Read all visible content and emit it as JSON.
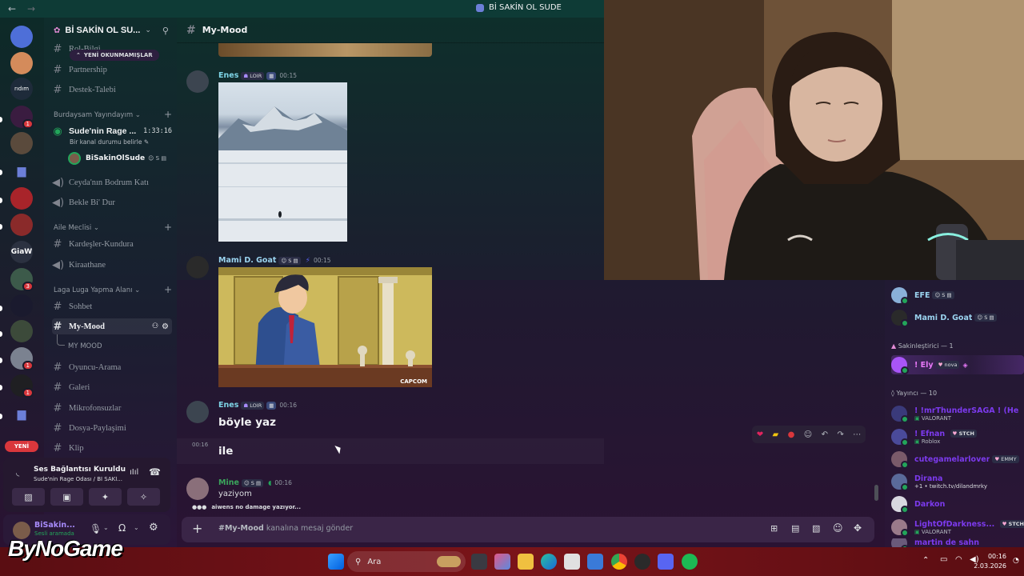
{
  "window": {
    "title": "Bİ SAKİN OL SUDE"
  },
  "server": {
    "name": "Bİ SAKİN OL SU...",
    "unread_pill": "YENİ OKUNMAMIŞLAR",
    "new_pill": "YENİ",
    "badges": [
      "1",
      "1",
      "3",
      "1",
      "1"
    ]
  },
  "channels": {
    "partial_top": "Rol-Bilgi",
    "partnership": "Partnership",
    "destek": "Destek-Talebi",
    "cat_burdaysam": "Burdaysam Yayındayım",
    "voice_active": {
      "name": "Sude'nin Rage ...",
      "timer": "1:33:16",
      "status": "Bir kanal durumu belirle",
      "member": "BiSakinOlSude"
    },
    "ceyda": "Ceyda'nın Bodrum Katı",
    "bekle": "Bekle Bi' Dur",
    "cat_aile": "Aile Meclisi",
    "kardesler": "Kardeşler-Kundura",
    "kiraathane": "Kiraathane",
    "cat_laga": "Laga Luga Yapma Alanı",
    "sohbet": "Sohbet",
    "mymood": "My-Mood",
    "thread": "MY MOOD",
    "oyuncu": "Oyuncu-Arama",
    "galeri": "Galeri",
    "mikrofonsuzlar": "Mikrofonsuzlar",
    "dosya": "Dosya-Paylaşimi",
    "klip": "Klip"
  },
  "voice_panel": {
    "status": "Ses Bağlantısı Kuruldu",
    "location": "Sude'nin Rage Odası / Bİ SAKİ..."
  },
  "user_panel": {
    "name": "BiSakin...",
    "status": "Sesli aramada"
  },
  "chat": {
    "channel": "My-Mood",
    "messages": [
      {
        "author": "Enes",
        "tag": "LOIR",
        "time": "00:15"
      },
      {
        "author": "Mami D. Goat",
        "tag": "S",
        "time": "00:15"
      },
      {
        "author": "Enes",
        "tag": "LOIR",
        "time": "00:16",
        "text": "böyle yaz"
      },
      {
        "time_side": "00:16",
        "text": "ile"
      },
      {
        "author": "Mine",
        "tag": "S",
        "time": "00:16",
        "text": "yaziyom"
      }
    ],
    "court_caption": "CAPCOM",
    "typing": "aiwens no damage yazıyor...",
    "composer_placeholder": "#My-Mood kanalına mesaj gönder",
    "composer_prefix": "#My-Mood",
    "composer_suffix": "kanalına mesaj gönder"
  },
  "members": {
    "list_top": [
      {
        "name": "EFE",
        "color": "#9bd4f0"
      },
      {
        "name": "Mami D. Goat",
        "color": "#9bd4f0"
      }
    ],
    "cat_sakin": "Sakinleştirici — 1",
    "ely": {
      "name": "! Ely",
      "tag": "nova"
    },
    "cat_yayinci": "Yayıncı — 10",
    "streamers": [
      {
        "name": "! !mrThunderSAGA ! (Hell...",
        "sub": "VALORANT",
        "color": "#8b5cf6"
      },
      {
        "name": "! Efnan",
        "tag": "STCH",
        "sub": "Roblox",
        "color": "#8b5cf6"
      },
      {
        "name": "cutegamelarlover",
        "tag": "EMMY",
        "sub": "",
        "color": "#8b5cf6"
      },
      {
        "name": "Dirana",
        "sub": "+1 • twitch.tv/dilandmrky",
        "color": "#8b5cf6"
      },
      {
        "name": "Darkon",
        "sub": "",
        "color": "#8b5cf6"
      },
      {
        "name": "LightOfDarkness...",
        "tag": "STCH",
        "sub": "VALORANT",
        "color": "#8b5cf6"
      },
      {
        "name": "martin de sahn",
        "sub": "",
        "color": "#8b5cf6"
      }
    ]
  },
  "taskbar": {
    "search": "Ara",
    "time": "00:16",
    "date": "2.03.2026"
  },
  "logo": "ByNoGame"
}
